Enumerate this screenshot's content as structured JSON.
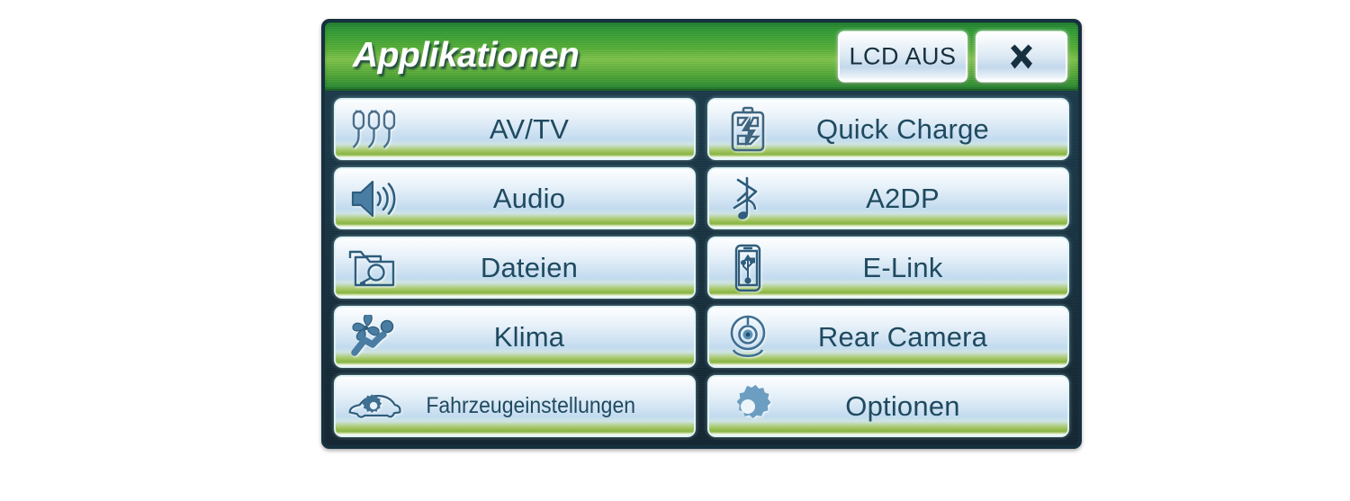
{
  "header": {
    "title": "Applikationen",
    "lcd_off_label": "LCD AUS",
    "close_icon": "close-x-icon"
  },
  "colors": {
    "frame": "#16303f",
    "screen_bg": "#17313f",
    "header_green": "#55ad35",
    "header_green_bright": "#7dc24a",
    "button_text": "#1f4a60",
    "button_top": "#fdfefe",
    "button_mid": "#c2dbef",
    "button_bottom_green": "#88b544"
  },
  "grid": {
    "columns": 2,
    "rows": 5,
    "buttons": [
      {
        "label": "AV/TV",
        "icon": "rca-connectors-icon",
        "column": "left",
        "row": 1,
        "condensed": false
      },
      {
        "label": "Quick Charge",
        "icon": "battery-bolt-icon",
        "column": "right",
        "row": 1,
        "condensed": false
      },
      {
        "label": "Audio",
        "icon": "speaker-waves-icon",
        "column": "left",
        "row": 2,
        "condensed": false
      },
      {
        "label": "A2DP",
        "icon": "bluetooth-note-icon",
        "column": "right",
        "row": 2,
        "condensed": false
      },
      {
        "label": "Dateien",
        "icon": "folder-search-icon",
        "column": "left",
        "row": 3,
        "condensed": false
      },
      {
        "label": "E-Link",
        "icon": "phone-usb-icon",
        "column": "right",
        "row": 3,
        "condensed": false
      },
      {
        "label": "Klima",
        "icon": "fan-person-icon",
        "column": "left",
        "row": 4,
        "condensed": false
      },
      {
        "label": "Rear Camera",
        "icon": "camera-lens-icon",
        "column": "right",
        "row": 4,
        "condensed": false
      },
      {
        "label": "Fahrzeugeinstellungen",
        "icon": "car-gear-icon",
        "column": "left",
        "row": 5,
        "condensed": true
      },
      {
        "label": "Optionen",
        "icon": "gear-icon",
        "column": "right",
        "row": 5,
        "condensed": false
      }
    ]
  }
}
